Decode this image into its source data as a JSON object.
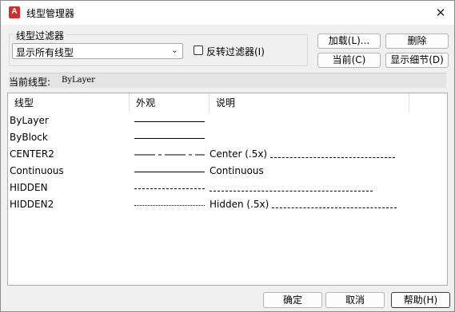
{
  "window": {
    "app_icon_text": "A",
    "title": "线型管理器",
    "close_glyph": "✕"
  },
  "filter": {
    "group_label": "线型过滤器",
    "selected": "显示所有线型",
    "reverse_label": "反转过滤器(I)",
    "reverse_checked": false
  },
  "buttons": {
    "load": "加载(L)...",
    "delete": "删除",
    "current": "当前(C)",
    "show_details": "显示细节(D)"
  },
  "current_linetype": {
    "label": "当前线型:",
    "value": "ByLayer"
  },
  "table": {
    "headers": [
      "线型",
      "外观",
      "说明"
    ],
    "rows": [
      {
        "name": "ByLayer",
        "appearance": "solid",
        "description": "",
        "description_pattern": ""
      },
      {
        "name": "ByBlock",
        "appearance": "solid",
        "description": "",
        "description_pattern": ""
      },
      {
        "name": "CENTER2",
        "appearance": "center",
        "description": "Center (.5x)",
        "description_pattern": "center"
      },
      {
        "name": "Continuous",
        "appearance": "solid",
        "description": "Continuous",
        "description_pattern": ""
      },
      {
        "name": "HIDDEN",
        "appearance": "hidden",
        "description": "",
        "description_pattern": "hidden"
      },
      {
        "name": "HIDDEN2",
        "appearance": "hidden2",
        "description": "Hidden (.5x)",
        "description_pattern": "hidden"
      }
    ]
  },
  "footer": {
    "ok": "确定",
    "cancel": "取消",
    "help": "帮助(H)"
  }
}
